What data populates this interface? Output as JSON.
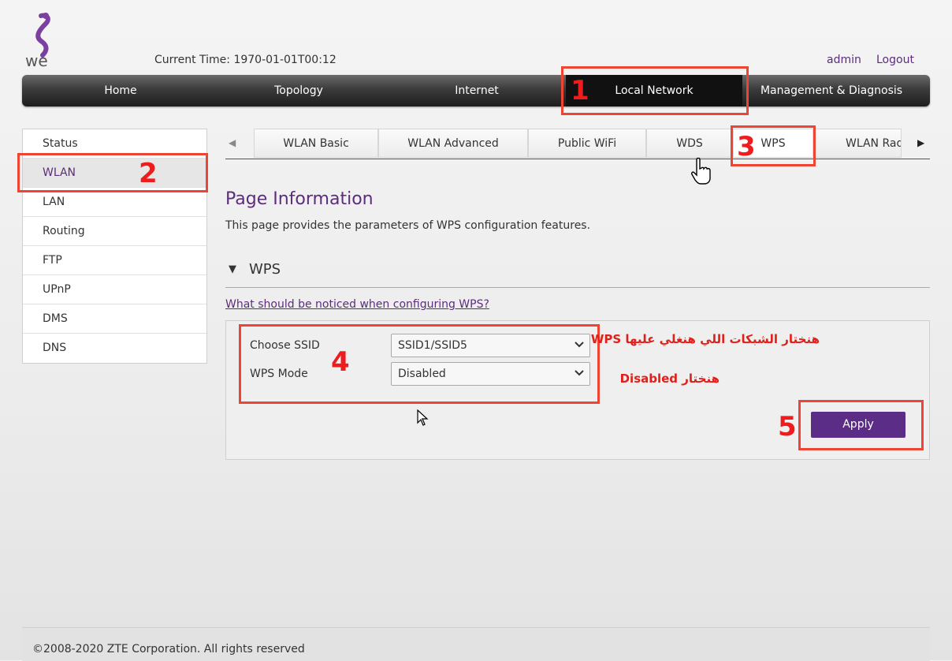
{
  "header": {
    "current_time": "Current Time: 1970-01-01T00:12",
    "user": "admin",
    "logout": "Logout"
  },
  "nav": {
    "items": [
      {
        "label": "Home"
      },
      {
        "label": "Topology"
      },
      {
        "label": "Internet"
      },
      {
        "label": "Local Network",
        "active": true
      },
      {
        "label": "Management & Diagnosis"
      }
    ]
  },
  "sidebar": {
    "items": [
      {
        "label": "Status"
      },
      {
        "label": "WLAN",
        "active": true
      },
      {
        "label": "LAN"
      },
      {
        "label": "Routing"
      },
      {
        "label": "FTP"
      },
      {
        "label": "UPnP"
      },
      {
        "label": "DMS"
      },
      {
        "label": "DNS"
      }
    ]
  },
  "tabs": {
    "items": [
      {
        "label": "WLAN Basic"
      },
      {
        "label": "WLAN Advanced"
      },
      {
        "label": "Public WiFi"
      },
      {
        "label": "WDS"
      },
      {
        "label": "WPS",
        "active": true
      },
      {
        "label": "WLAN Rad"
      }
    ]
  },
  "page": {
    "title": "Page Information",
    "description": "This page provides the parameters of WPS configuration features.",
    "section_title": "WPS",
    "help_link": "What should be noticed when configuring WPS?"
  },
  "form": {
    "ssid_label": "Choose SSID",
    "ssid_value": "SSID1/SSID5",
    "mode_label": "WPS Mode",
    "mode_value": "Disabled",
    "apply": "Apply"
  },
  "annotations": {
    "numbers": [
      "1",
      "2",
      "3",
      "4",
      "5"
    ],
    "note_ssid": "هنختار الشبكات اللي هنغلي عليها WPS",
    "note_mode": "هنختار Disabled",
    "color": "#ee4433"
  },
  "footer": {
    "copyright": "©2008-2020 ZTE Corporation. All rights reserved"
  },
  "colors": {
    "brand_purple": "#5b2d86",
    "nav_dark": "#1e1e1e"
  }
}
